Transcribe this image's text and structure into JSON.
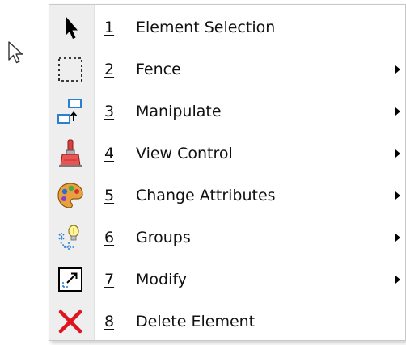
{
  "menu": {
    "items": [
      {
        "number": "1",
        "label": "Element Selection",
        "icon": "element-selection-arrow-icon",
        "submenu": false
      },
      {
        "number": "2",
        "label": "Fence",
        "icon": "fence-dashed-rectangle-icon",
        "submenu": true
      },
      {
        "number": "3",
        "label": "Manipulate",
        "icon": "manipulate-icon",
        "submenu": true
      },
      {
        "number": "4",
        "label": "View Control",
        "icon": "paintbrush-icon",
        "submenu": true
      },
      {
        "number": "5",
        "label": "Change Attributes",
        "icon": "palette-icon",
        "submenu": true
      },
      {
        "number": "6",
        "label": "Groups",
        "icon": "groups-lightbulb-icon",
        "submenu": true
      },
      {
        "number": "7",
        "label": "Modify",
        "icon": "modify-icon",
        "submenu": true
      },
      {
        "number": "8",
        "label": "Delete Element",
        "icon": "delete-x-icon",
        "submenu": false
      }
    ]
  },
  "colors": {
    "gutter": "#eeeeee",
    "border": "#c9c9c9",
    "delete_red": "#e0141e",
    "icon_blue": "#2a7fd0"
  }
}
